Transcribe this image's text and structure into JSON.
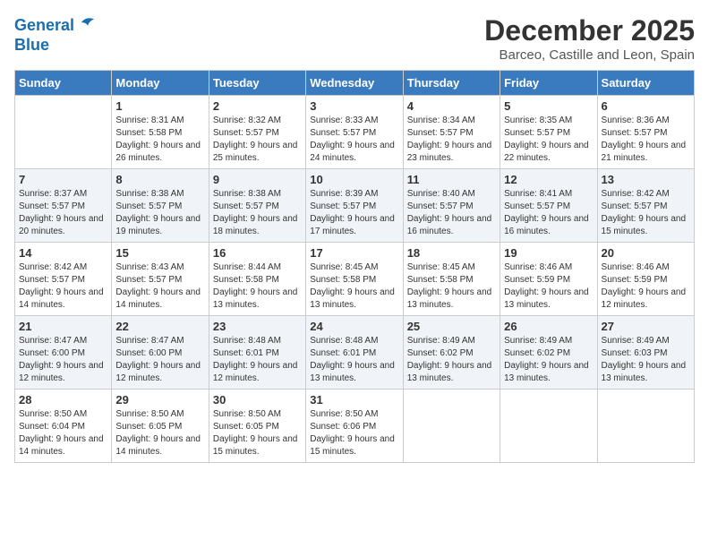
{
  "logo": {
    "line1": "General",
    "line2": "Blue"
  },
  "title": "December 2025",
  "subtitle": "Barceo, Castille and Leon, Spain",
  "days_of_week": [
    "Sunday",
    "Monday",
    "Tuesday",
    "Wednesday",
    "Thursday",
    "Friday",
    "Saturday"
  ],
  "weeks": [
    [
      {
        "day": "",
        "sunrise": "",
        "sunset": "",
        "daylight": ""
      },
      {
        "day": "1",
        "sunrise": "8:31 AM",
        "sunset": "5:58 PM",
        "daylight": "9 hours and 26 minutes."
      },
      {
        "day": "2",
        "sunrise": "8:32 AM",
        "sunset": "5:57 PM",
        "daylight": "9 hours and 25 minutes."
      },
      {
        "day": "3",
        "sunrise": "8:33 AM",
        "sunset": "5:57 PM",
        "daylight": "9 hours and 24 minutes."
      },
      {
        "day": "4",
        "sunrise": "8:34 AM",
        "sunset": "5:57 PM",
        "daylight": "9 hours and 23 minutes."
      },
      {
        "day": "5",
        "sunrise": "8:35 AM",
        "sunset": "5:57 PM",
        "daylight": "9 hours and 22 minutes."
      },
      {
        "day": "6",
        "sunrise": "8:36 AM",
        "sunset": "5:57 PM",
        "daylight": "9 hours and 21 minutes."
      }
    ],
    [
      {
        "day": "7",
        "sunrise": "8:37 AM",
        "sunset": "5:57 PM",
        "daylight": "9 hours and 20 minutes."
      },
      {
        "day": "8",
        "sunrise": "8:38 AM",
        "sunset": "5:57 PM",
        "daylight": "9 hours and 19 minutes."
      },
      {
        "day": "9",
        "sunrise": "8:38 AM",
        "sunset": "5:57 PM",
        "daylight": "9 hours and 18 minutes."
      },
      {
        "day": "10",
        "sunrise": "8:39 AM",
        "sunset": "5:57 PM",
        "daylight": "9 hours and 17 minutes."
      },
      {
        "day": "11",
        "sunrise": "8:40 AM",
        "sunset": "5:57 PM",
        "daylight": "9 hours and 16 minutes."
      },
      {
        "day": "12",
        "sunrise": "8:41 AM",
        "sunset": "5:57 PM",
        "daylight": "9 hours and 16 minutes."
      },
      {
        "day": "13",
        "sunrise": "8:42 AM",
        "sunset": "5:57 PM",
        "daylight": "9 hours and 15 minutes."
      }
    ],
    [
      {
        "day": "14",
        "sunrise": "8:42 AM",
        "sunset": "5:57 PM",
        "daylight": "9 hours and 14 minutes."
      },
      {
        "day": "15",
        "sunrise": "8:43 AM",
        "sunset": "5:57 PM",
        "daylight": "9 hours and 14 minutes."
      },
      {
        "day": "16",
        "sunrise": "8:44 AM",
        "sunset": "5:58 PM",
        "daylight": "9 hours and 13 minutes."
      },
      {
        "day": "17",
        "sunrise": "8:45 AM",
        "sunset": "5:58 PM",
        "daylight": "9 hours and 13 minutes."
      },
      {
        "day": "18",
        "sunrise": "8:45 AM",
        "sunset": "5:58 PM",
        "daylight": "9 hours and 13 minutes."
      },
      {
        "day": "19",
        "sunrise": "8:46 AM",
        "sunset": "5:59 PM",
        "daylight": "9 hours and 13 minutes."
      },
      {
        "day": "20",
        "sunrise": "8:46 AM",
        "sunset": "5:59 PM",
        "daylight": "9 hours and 12 minutes."
      }
    ],
    [
      {
        "day": "21",
        "sunrise": "8:47 AM",
        "sunset": "6:00 PM",
        "daylight": "9 hours and 12 minutes."
      },
      {
        "day": "22",
        "sunrise": "8:47 AM",
        "sunset": "6:00 PM",
        "daylight": "9 hours and 12 minutes."
      },
      {
        "day": "23",
        "sunrise": "8:48 AM",
        "sunset": "6:01 PM",
        "daylight": "9 hours and 12 minutes."
      },
      {
        "day": "24",
        "sunrise": "8:48 AM",
        "sunset": "6:01 PM",
        "daylight": "9 hours and 13 minutes."
      },
      {
        "day": "25",
        "sunrise": "8:49 AM",
        "sunset": "6:02 PM",
        "daylight": "9 hours and 13 minutes."
      },
      {
        "day": "26",
        "sunrise": "8:49 AM",
        "sunset": "6:02 PM",
        "daylight": "9 hours and 13 minutes."
      },
      {
        "day": "27",
        "sunrise": "8:49 AM",
        "sunset": "6:03 PM",
        "daylight": "9 hours and 13 minutes."
      }
    ],
    [
      {
        "day": "28",
        "sunrise": "8:50 AM",
        "sunset": "6:04 PM",
        "daylight": "9 hours and 14 minutes."
      },
      {
        "day": "29",
        "sunrise": "8:50 AM",
        "sunset": "6:05 PM",
        "daylight": "9 hours and 14 minutes."
      },
      {
        "day": "30",
        "sunrise": "8:50 AM",
        "sunset": "6:05 PM",
        "daylight": "9 hours and 15 minutes."
      },
      {
        "day": "31",
        "sunrise": "8:50 AM",
        "sunset": "6:06 PM",
        "daylight": "9 hours and 15 minutes."
      },
      {
        "day": "",
        "sunrise": "",
        "sunset": "",
        "daylight": ""
      },
      {
        "day": "",
        "sunrise": "",
        "sunset": "",
        "daylight": ""
      },
      {
        "day": "",
        "sunrise": "",
        "sunset": "",
        "daylight": ""
      }
    ]
  ],
  "labels": {
    "sunrise": "Sunrise:",
    "sunset": "Sunset:",
    "daylight": "Daylight:"
  }
}
